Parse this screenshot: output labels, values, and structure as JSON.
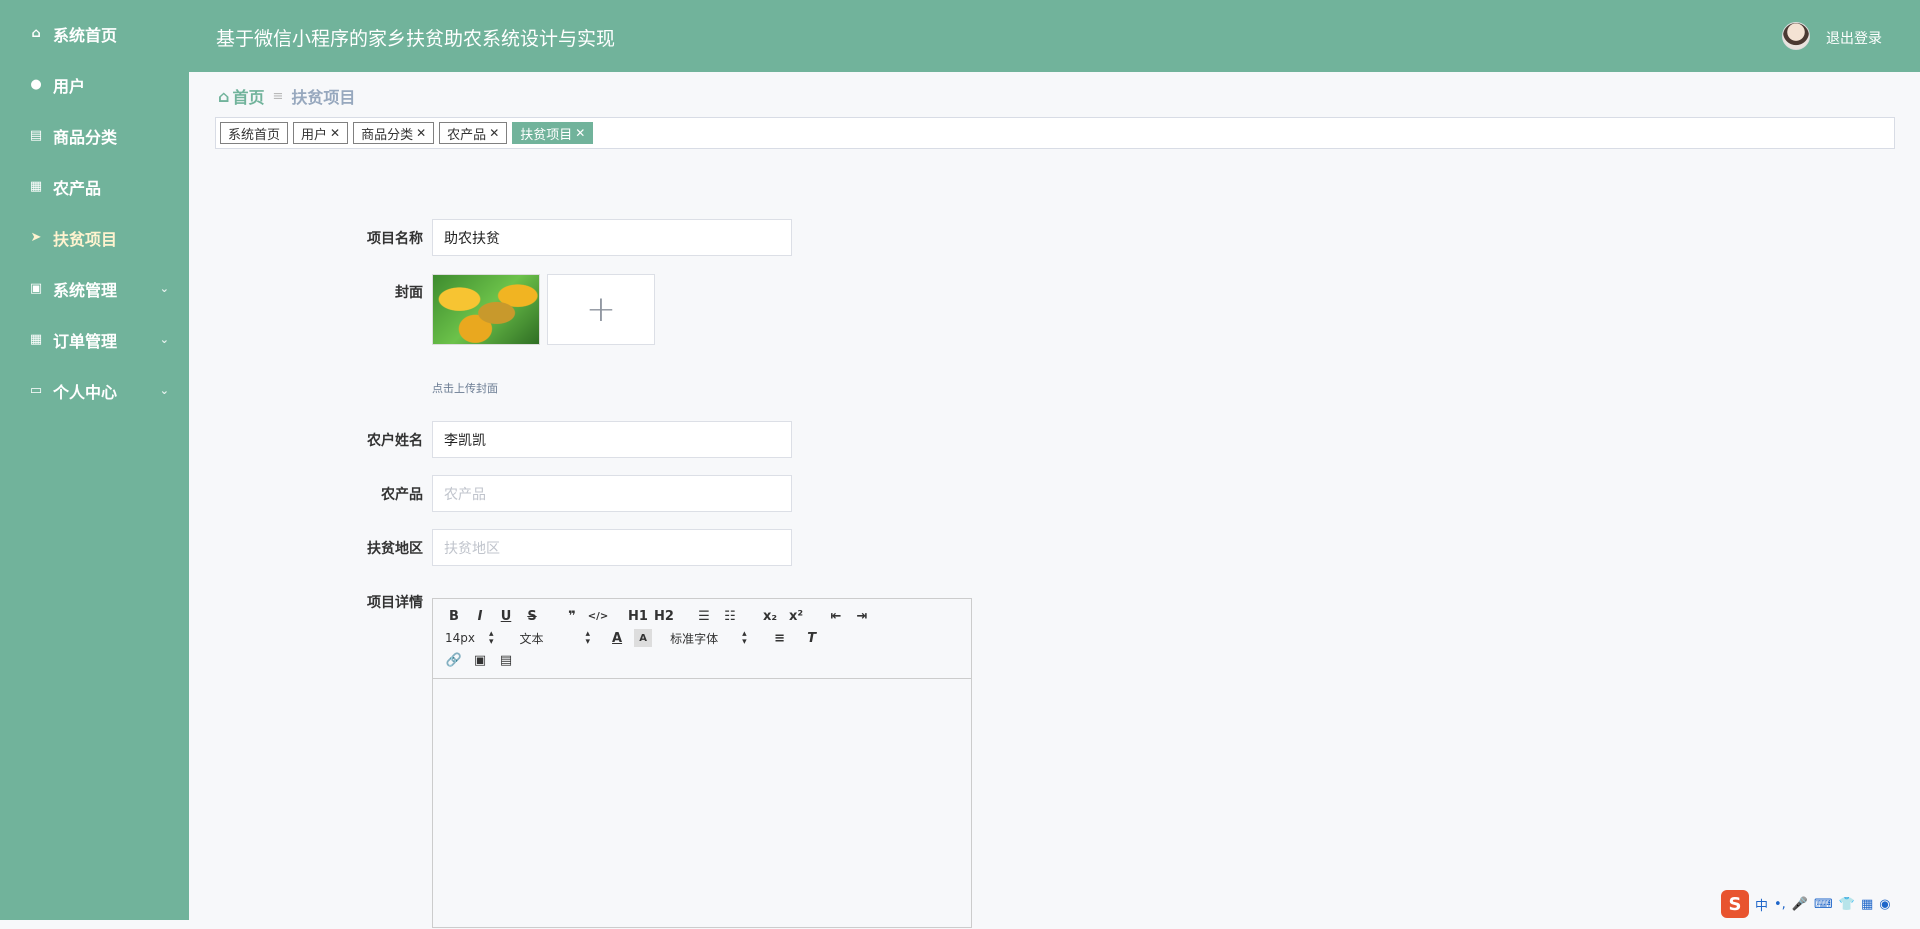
{
  "header": {
    "title": "基于微信小程序的家乡扶贫助农系统设计与实现",
    "logout": "退出登录"
  },
  "sidebar": {
    "items": [
      {
        "label": "系统首页",
        "icon": "home-icon"
      },
      {
        "label": "用户",
        "icon": "user-icon"
      },
      {
        "label": "商品分类",
        "icon": "document-icon"
      },
      {
        "label": "农产品",
        "icon": "grid-icon"
      },
      {
        "label": "扶贫项目",
        "icon": "send-icon",
        "active": true
      },
      {
        "label": "系统管理",
        "icon": "clipboard-icon",
        "expandable": true
      },
      {
        "label": "订单管理",
        "icon": "grid-icon",
        "expandable": true
      },
      {
        "label": "个人中心",
        "icon": "card-icon",
        "expandable": true
      }
    ]
  },
  "breadcrumb": {
    "home": "首页",
    "current": "扶贫项目"
  },
  "tags": [
    {
      "label": "系统首页",
      "closable": false
    },
    {
      "label": "用户",
      "closable": true
    },
    {
      "label": "商品分类",
      "closable": true
    },
    {
      "label": "农产品",
      "closable": true
    },
    {
      "label": "扶贫项目",
      "closable": true,
      "active": true
    }
  ],
  "form": {
    "project_name": {
      "label": "项目名称",
      "value": "助农扶贫"
    },
    "cover": {
      "label": "封面",
      "tip": "点击上传封面",
      "add_symbol": "+"
    },
    "farmer_name": {
      "label": "农户姓名",
      "value": "李凯凯"
    },
    "product": {
      "label": "农产品",
      "placeholder": "农产品"
    },
    "region": {
      "label": "扶贫地区",
      "placeholder": "扶贫地区"
    },
    "detail": {
      "label": "项目详情"
    }
  },
  "editor": {
    "toolbar_row1": [
      "B",
      "I",
      "U",
      "S",
      "❞",
      "</>",
      "H1",
      "H2",
      "ol",
      "ul",
      "x₂",
      "x²",
      "outdent",
      "indent"
    ],
    "font_size": "14px",
    "text_type": "文本",
    "font_family": "标准字体"
  },
  "ime": {
    "logo": "S",
    "mode": "中"
  },
  "colors": {
    "theme": "#71b39b",
    "active_sidebar_text": "#fff3cf"
  }
}
